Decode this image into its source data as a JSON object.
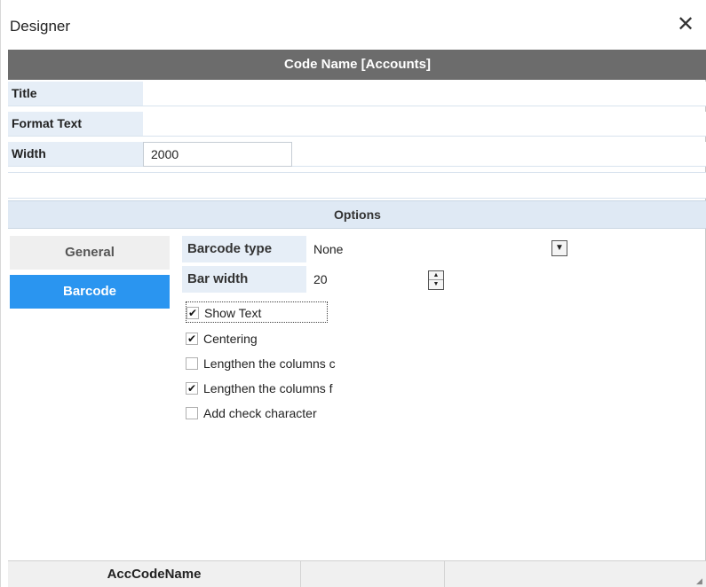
{
  "window": {
    "title": "Designer",
    "close_symbol": "✕"
  },
  "header": {
    "title": "Code Name [Accounts]"
  },
  "properties": {
    "title_label": "Title",
    "format_text_label": "Format Text",
    "width_label": "Width",
    "width_value": "2000"
  },
  "options": {
    "title": "Options"
  },
  "tabs": {
    "general": "General",
    "barcode": "Barcode",
    "active": "Barcode"
  },
  "barcode": {
    "type_label": "Barcode type",
    "type_value": "None",
    "bar_width_label": "Bar width",
    "bar_width_value": "20",
    "checkboxes": [
      {
        "label": "Show Text",
        "checked": "✔"
      },
      {
        "label": "Centering",
        "checked": "✔"
      },
      {
        "label": "Lengthen the columns c",
        "checked": ""
      },
      {
        "label": "Lengthen the columns f",
        "checked": "✔"
      },
      {
        "label": "Add check character",
        "checked": ""
      }
    ]
  },
  "footer": {
    "column_1": "AccCodeName",
    "column_2": "",
    "column_3": ""
  },
  "icons": {
    "dropdown": "chevron-down-icon",
    "spinner": "spinner-icon",
    "close": "close-icon"
  },
  "colors": {
    "header_bg": "#6c6c6c",
    "active_tab": "#2a95f0",
    "label_bg": "#e6eef7"
  }
}
